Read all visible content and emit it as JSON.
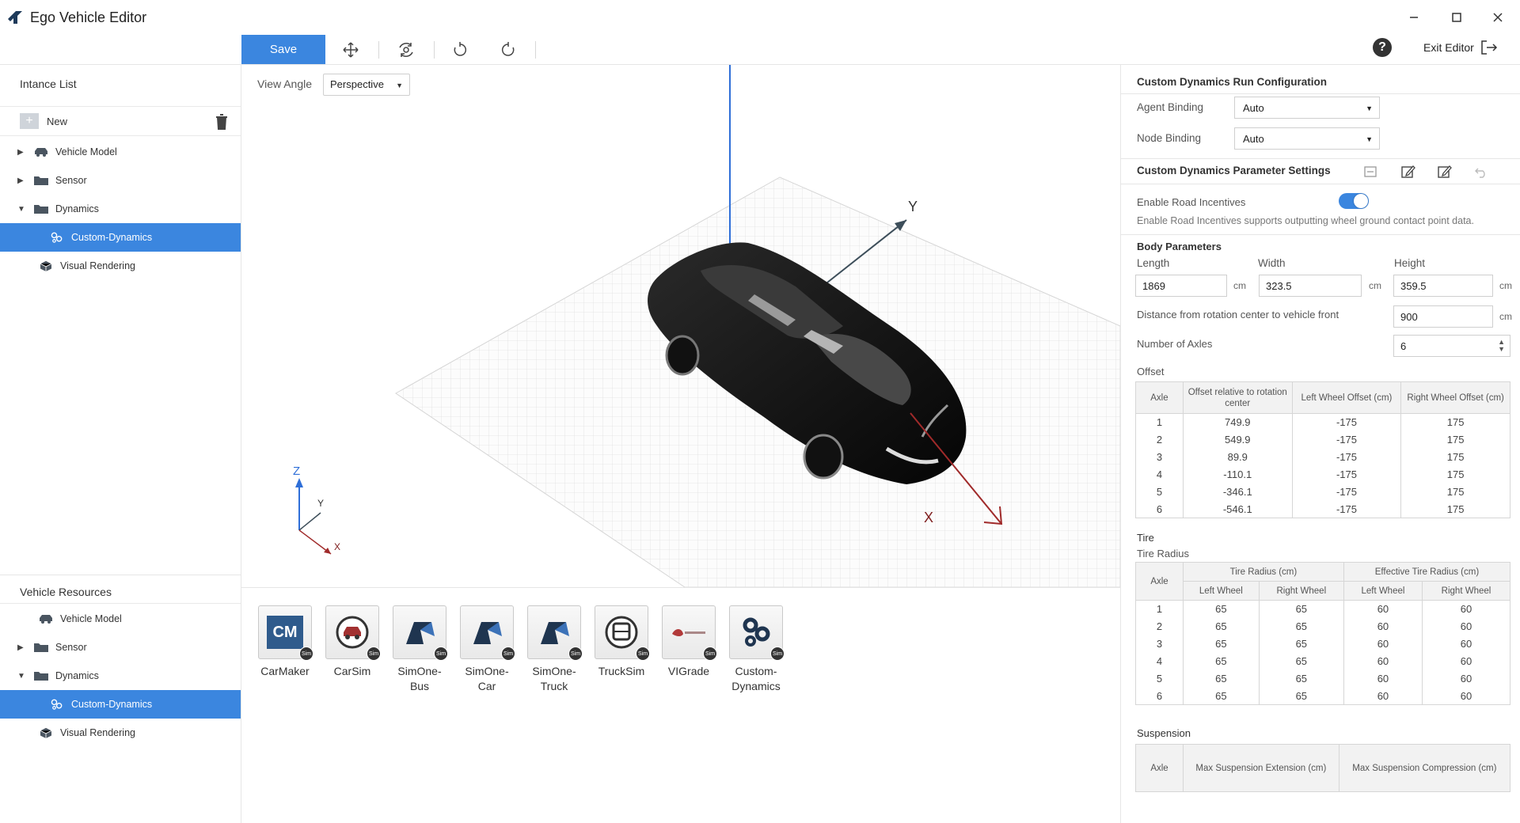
{
  "app": {
    "title": "Ego Vehicle Editor"
  },
  "toolbar": {
    "save_label": "Save",
    "exit_label": "Exit Editor",
    "help_label": "?"
  },
  "instance_list": {
    "title": "Intance List",
    "new_label": "New",
    "items": [
      {
        "label": "Vehicle Model",
        "expandable": true,
        "expanded": false
      },
      {
        "label": "Sensor",
        "expandable": true,
        "expanded": false
      },
      {
        "label": "Dynamics",
        "expandable": true,
        "expanded": true
      },
      {
        "label": "Custom-Dynamics",
        "child": true,
        "selected": true
      },
      {
        "label": "Visual Rendering",
        "expandable": false
      }
    ]
  },
  "vehicle_resources": {
    "title": "Vehicle Resources",
    "items": [
      {
        "label": "Vehicle Model"
      },
      {
        "label": "Sensor"
      },
      {
        "label": "Dynamics"
      },
      {
        "label": "Custom-Dynamics"
      },
      {
        "label": "Visual Rendering"
      }
    ]
  },
  "viewport": {
    "view_angle_label": "View Angle",
    "view_angle_value": "Perspective",
    "axis_labels": {
      "y": "Y",
      "x": "X"
    },
    "gizmo_labels": {
      "z": "Z",
      "y": "Y",
      "x": "X"
    }
  },
  "resources": [
    {
      "label_lines": [
        "CarMaker"
      ],
      "tile_text": "CM",
      "badge": "Sim"
    },
    {
      "label_lines": [
        "CarSim"
      ],
      "badge": "Sim"
    },
    {
      "label_lines": [
        "SimOne-",
        "Bus"
      ],
      "badge": "Sim"
    },
    {
      "label_lines": [
        "SimOne-",
        "Car"
      ],
      "badge": "Sim"
    },
    {
      "label_lines": [
        "SimOne-",
        "Truck"
      ],
      "badge": "Sim"
    },
    {
      "label_lines": [
        "TruckSim"
      ],
      "badge": "Sim"
    },
    {
      "label_lines": [
        "VIGrade"
      ],
      "badge": "Sim"
    },
    {
      "label_lines": [
        "Custom-",
        "Dynamics"
      ],
      "badge": "Sim"
    }
  ],
  "run_config": {
    "title": "Custom Dynamics Run Configuration",
    "agent_binding_label": "Agent Binding",
    "agent_binding_value": "Auto",
    "node_binding_label": "Node Binding",
    "node_binding_value": "Auto"
  },
  "param_settings": {
    "title": "Custom Dynamics Parameter Settings",
    "road_incentives_label": "Enable Road Incentives",
    "road_incentives_enabled": true,
    "road_incentives_desc": "Enable Road Incentives supports outputting wheel ground contact point data."
  },
  "body": {
    "title": "Body Parameters",
    "length_label": "Length",
    "length_value": "1869",
    "width_label": "Width",
    "width_value": "323.5",
    "height_label": "Height",
    "height_value": "359.5",
    "unit": "cm",
    "distance_label": "Distance from rotation center to vehicle front",
    "distance_value": "900",
    "axles_label": "Number of Axles",
    "axles_value": "6"
  },
  "offset": {
    "title": "Offset",
    "headers": [
      "Axle",
      "Offset relative to rotation center",
      "Left Wheel Offset (cm)",
      "Right Wheel Offset (cm)"
    ],
    "rows": [
      [
        "1",
        "749.9",
        "-175",
        "175"
      ],
      [
        "2",
        "549.9",
        "-175",
        "175"
      ],
      [
        "3",
        "89.9",
        "-175",
        "175"
      ],
      [
        "4",
        "-110.1",
        "-175",
        "175"
      ],
      [
        "5",
        "-346.1",
        "-175",
        "175"
      ],
      [
        "6",
        "-546.1",
        "-175",
        "175"
      ]
    ]
  },
  "tire": {
    "title": "Tire",
    "subtitle": "Tire Radius",
    "headers": {
      "axle": "Axle",
      "group1": "Tire Radius (cm)",
      "group2": "Effective Tire Radius (cm)",
      "left": "Left Wheel",
      "right": "Right Wheel"
    },
    "rows": [
      [
        "1",
        "65",
        "65",
        "60",
        "60"
      ],
      [
        "2",
        "65",
        "65",
        "60",
        "60"
      ],
      [
        "3",
        "65",
        "65",
        "60",
        "60"
      ],
      [
        "4",
        "65",
        "65",
        "60",
        "60"
      ],
      [
        "5",
        "65",
        "65",
        "60",
        "60"
      ],
      [
        "6",
        "65",
        "65",
        "60",
        "60"
      ]
    ]
  },
  "suspension": {
    "title": "Suspension",
    "headers": [
      "Axle",
      "Max Suspension Extension (cm)",
      "Max Suspension Compression (cm)"
    ]
  },
  "colors": {
    "accent": "#3b86df",
    "axis_z": "#2f6fd8",
    "axis_y": "#3d4e5a",
    "axis_x": "#a02a2a"
  }
}
